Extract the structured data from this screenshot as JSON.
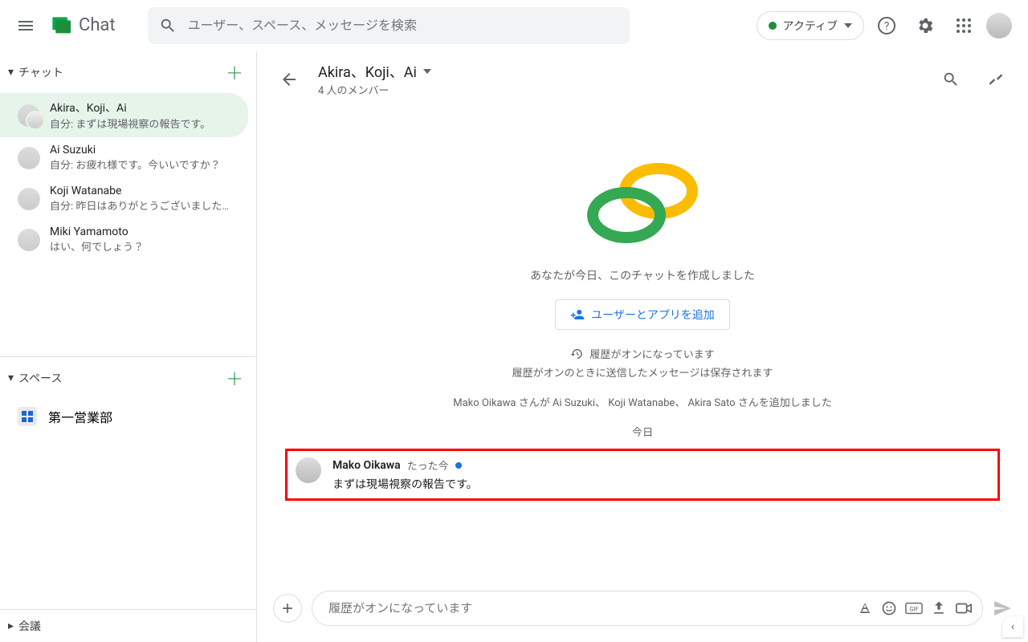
{
  "header": {
    "app_name": "Chat",
    "search_placeholder": "ユーザー、スペース、メッセージを検索",
    "status_label": "アクティブ"
  },
  "sidebar": {
    "chat_section_label": "チャット",
    "space_section_label": "スペース",
    "meeting_section_label": "会議",
    "chats": [
      {
        "name": "Akira、Koji、Ai",
        "preview": "自分: まずは現場視察の報告です。",
        "active": true,
        "group": true
      },
      {
        "name": "Ai Suzuki",
        "preview": "自分: お疲れ様です。今いいですか？",
        "active": false,
        "group": false
      },
      {
        "name": "Koji Watanabe",
        "preview": "自分: 昨日はありがとうございました…",
        "active": false,
        "group": false
      },
      {
        "name": "Miki Yamamoto",
        "preview": "はい、何でしょう？",
        "active": false,
        "group": false
      }
    ],
    "spaces": [
      {
        "name": "第一営業部"
      }
    ]
  },
  "conversation": {
    "title": "Akira、Koji、Ai",
    "subtitle": "4 人のメンバー",
    "created_text": "あなたが今日、このチャットを作成しました",
    "add_button": "ユーザーとアプリを追加",
    "history_on": "履歴がオンになっています",
    "history_sub": "履歴がオンのときに送信したメッセージは保存されます",
    "added_line": "Mako Oikawa さんが Ai Suzuki、 Koji Watanabe、 Akira Sato さんを追加しました",
    "date_separator": "今日",
    "message": {
      "author": "Mako Oikawa",
      "time": "たった今",
      "body": "まずは現場視察の報告です。"
    },
    "compose_placeholder": "履歴がオンになっています"
  }
}
